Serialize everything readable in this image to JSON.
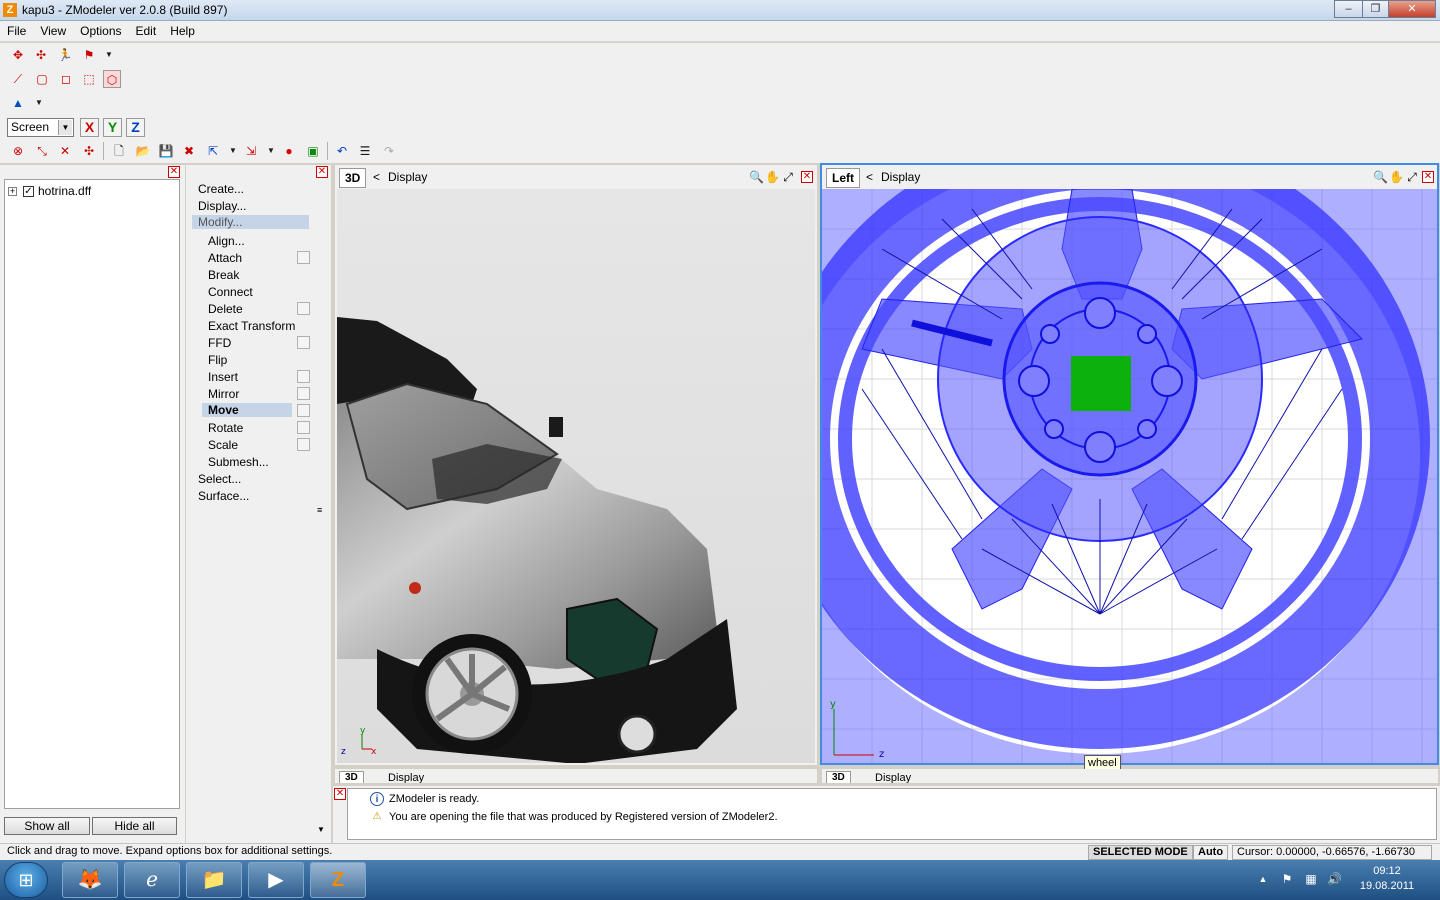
{
  "window": {
    "title": "kapu3 - ZModeler ver 2.0.8 (Build 897)",
    "app_icon": "Z",
    "minimize_label": "–",
    "maximize_label": "❐",
    "close_label": "✕"
  },
  "menu": {
    "file": "File",
    "view": "View",
    "options": "Options",
    "edit": "Edit",
    "help": "Help"
  },
  "toolbar": {
    "coord_system": "Screen",
    "axis_x": "X",
    "axis_y": "Y",
    "axis_z": "Z"
  },
  "tree": {
    "expander": "+",
    "checkbox": "✓",
    "file_item": "hotrina.dff",
    "show_all": "Show all",
    "hide_all": "Hide all"
  },
  "commands": {
    "create": "Create...",
    "display": "Display...",
    "modify": "Modify...",
    "align": "Align...",
    "attach": "Attach",
    "break": "Break",
    "connect": "Connect",
    "delete": "Delete",
    "exact_transform": "Exact Transform",
    "ffd": "FFD",
    "flip": "Flip",
    "insert": "Insert",
    "mirror": "Mirror",
    "move": "Move",
    "rotate": "Rotate",
    "scale": "Scale",
    "submesh": "Submesh...",
    "select": "Select...",
    "surface": "Surface..."
  },
  "viewports": {
    "v3d": {
      "name": "3D",
      "menu": "Display",
      "axis_y": "y",
      "axis_z": "z",
      "axis_x": "x"
    },
    "left": {
      "name": "Left",
      "menu": "Display",
      "axis_y": "y",
      "axis_z": "z",
      "tooltip": "wheel"
    },
    "lower_left": {
      "name": "3D",
      "menu": "Display"
    },
    "lower_right": {
      "name": "3D",
      "menu": "Display"
    }
  },
  "log": {
    "line1": "ZModeler is ready.",
    "line2": "You are opening the file that was produced by Registered version of ZModeler2."
  },
  "status": {
    "message": "Click and drag to move. Expand options box for additional settings.",
    "mode": "SELECTED MODE",
    "auto": "Auto",
    "cursor": "Cursor: 0.00000, -0.66576, -1.66730"
  },
  "taskbar": {
    "time": "09:12",
    "date": "19.08.2011"
  },
  "colors": {
    "mesh_blue": "#2a2aff",
    "selection_green": "#0db10d",
    "active_viewport_border": "#3d8de8"
  }
}
